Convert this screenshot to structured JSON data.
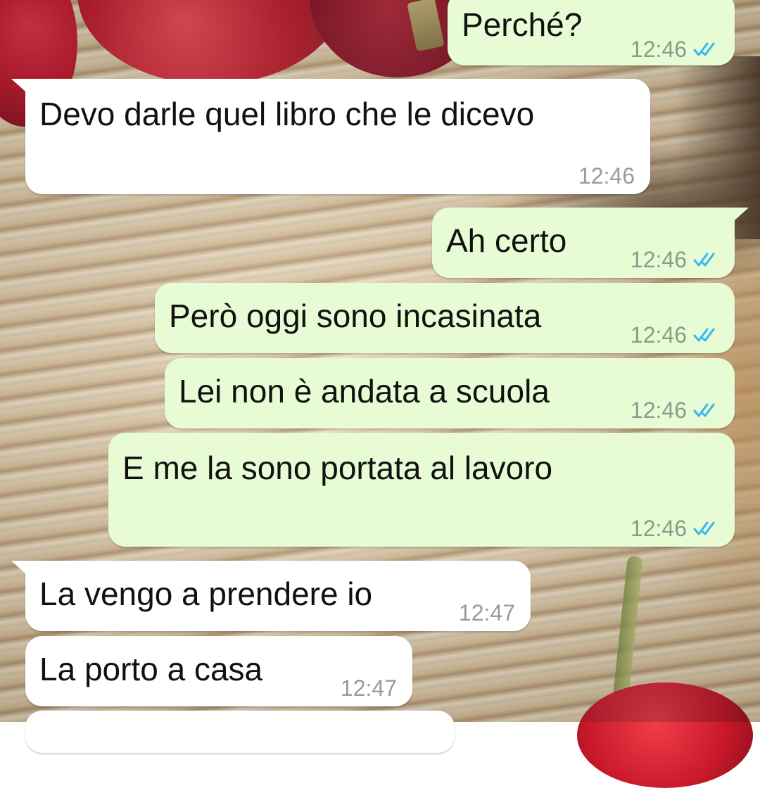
{
  "theme": {
    "outgoing_bubble": "#e7fcd5",
    "incoming_bubble": "#ffffff",
    "read_ticks_color": "#34b7f1"
  },
  "messages": [
    {
      "direction": "outgoing",
      "text": "Perché?",
      "time": "12:46",
      "status_icon": "double-check-read-icon"
    },
    {
      "direction": "incoming",
      "text": "Devo darle quel libro che le dicevo",
      "time": "12:46"
    },
    {
      "direction": "outgoing",
      "text": "Ah certo",
      "time": "12:46",
      "status_icon": "double-check-read-icon"
    },
    {
      "direction": "outgoing",
      "text": "Però oggi sono incasinata",
      "time": "12:46",
      "status_icon": "double-check-read-icon"
    },
    {
      "direction": "outgoing",
      "text": "Lei non è andata a scuola",
      "time": "12:46",
      "status_icon": "double-check-read-icon"
    },
    {
      "direction": "outgoing",
      "text": "E me la sono portata al lavoro",
      "time": "12:46",
      "status_icon": "double-check-read-icon"
    },
    {
      "direction": "incoming",
      "text": "La vengo a prendere io",
      "time": "12:47"
    },
    {
      "direction": "incoming",
      "text": "La porto a casa",
      "time": "12:47"
    }
  ]
}
